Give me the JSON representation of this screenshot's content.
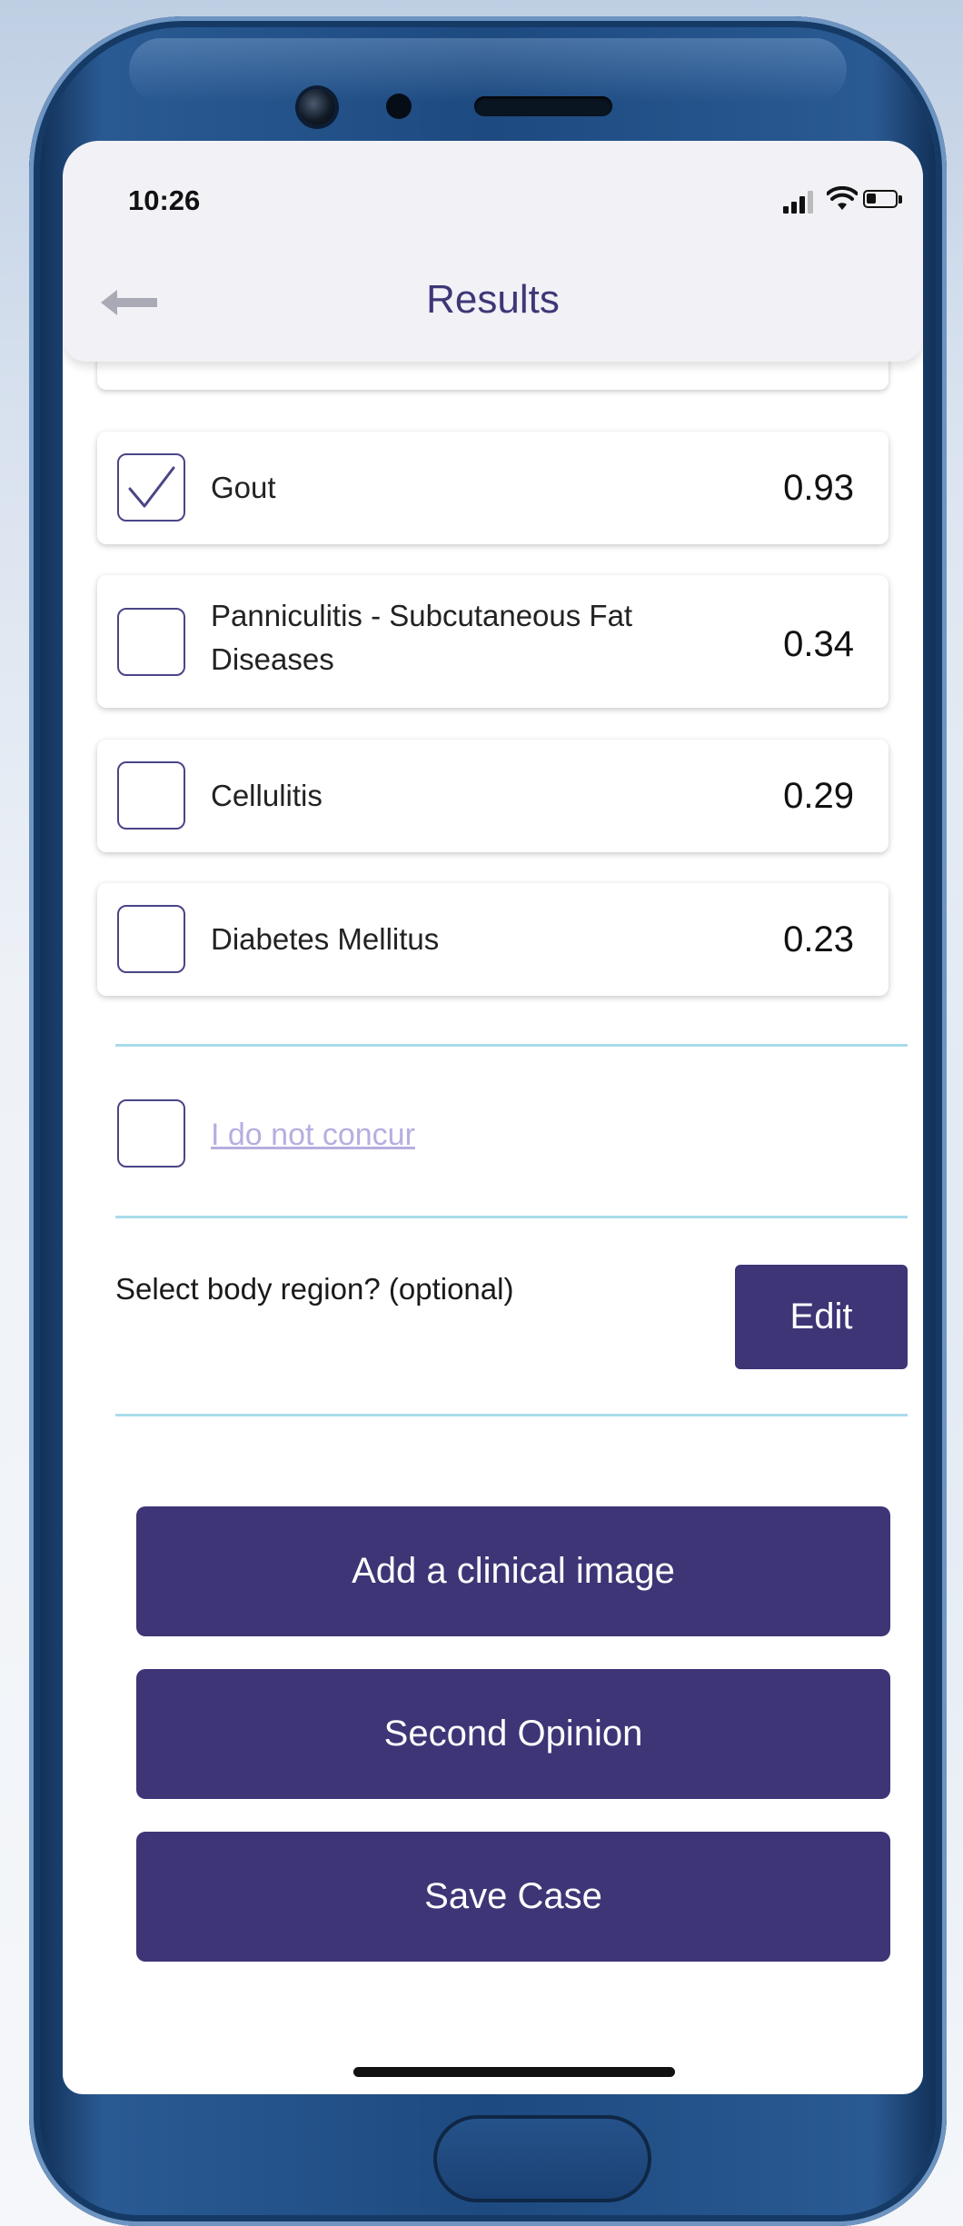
{
  "status_bar": {
    "time": "10:26"
  },
  "header": {
    "title": "Results"
  },
  "results": [
    {
      "label": "Gout",
      "score": "0.93",
      "checked": true
    },
    {
      "label": "Panniculitis - Subcutaneous Fat",
      "label_line2": "Diseases",
      "score": "0.34",
      "checked": false
    },
    {
      "label": "Cellulitis",
      "score": "0.29",
      "checked": false
    },
    {
      "label": "Diabetes Mellitus",
      "score": "0.23",
      "checked": false
    }
  ],
  "not_concur": {
    "label": "I do not concur",
    "checked": false
  },
  "body_region": {
    "label": "Select body region? (optional)",
    "button": "Edit"
  },
  "actions": {
    "add_image": "Add a clinical image",
    "second_opinion": "Second Opinion",
    "save_case": "Save Case"
  },
  "colors": {
    "accent": "#3d3576",
    "title": "#3d3777",
    "divider": "#a9dcea",
    "muted_link": "#b6aee0"
  },
  "icons": [
    "back-arrow-icon",
    "checkmark-icon",
    "signal-icon",
    "wifi-icon",
    "battery-icon"
  ]
}
